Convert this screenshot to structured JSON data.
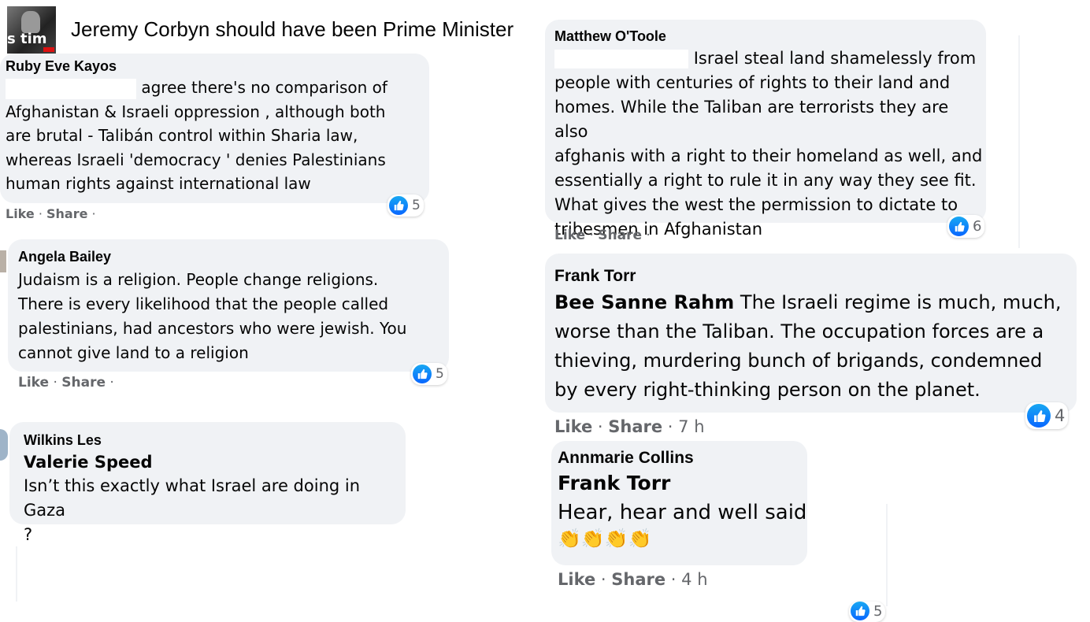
{
  "group": {
    "title": "Jeremy Corbyn should have been Prime Minister",
    "thumb_text": "s tim"
  },
  "colors": {
    "bubble": "#f0f2f5",
    "meta_text": "#65676b",
    "like_blue": "#0866ff"
  },
  "comments": [
    {
      "author": "Ruby Eve Kayos",
      "lines": [
        "agree there's no comparison of",
        "Afghanistan & Israeli oppression , although both",
        "are brutal - Talibán control within Sharia law,",
        "whereas Israeli 'democracy ' denies Palestinians",
        "human rights against international law"
      ],
      "like_label": "Like",
      "share_label": "Share",
      "reactions": "5"
    },
    {
      "author": "Angela Bailey",
      "lines": [
        "Judaism is a religion. People change religions.",
        "There is every likelihood that the people called",
        "palestinians, had ancestors who were jewish. You",
        "cannot give land to a religion"
      ],
      "like_label": "Like",
      "share_label": "Share",
      "reactions": "5"
    },
    {
      "author": "Wilkins Les",
      "mention": "Valerie Speed",
      "lines": [
        "Isn’t this exactly what Israel are doing in Gaza",
        "?"
      ]
    },
    {
      "author": "Matthew O'Toole",
      "lines": [
        "Israel steal land shamelessly from",
        "people with centuries of rights to their land and",
        "homes. While the Taliban are terrorists they are also",
        "afghanis with a right to their homeland as well, and",
        "essentially a right to rule it in any way they see fit.",
        "What gives the west the permission to dictate to",
        "tribesmen in Afghanistan"
      ],
      "like_label": "Like",
      "share_label": "Share",
      "reactions": "6"
    },
    {
      "author": "Frank Torr",
      "mention": "Bee Sanne Rahm",
      "lines": [
        "The Israeli regime is much, much,",
        "worse than the Taliban. The occupation forces are a",
        "thieving, murdering bunch of brigands, condemned",
        "by every right-thinking person on the planet."
      ],
      "like_label": "Like",
      "share_label": "Share",
      "time": "7 h",
      "reactions": "4"
    },
    {
      "author": "Annmarie Collins",
      "mention": "Frank Torr",
      "lines": [
        "Hear, hear and well said"
      ],
      "emoji": "👏👏👏👏",
      "like_label": "Like",
      "share_label": "Share",
      "time": "4 h",
      "reactions": "5"
    }
  ]
}
